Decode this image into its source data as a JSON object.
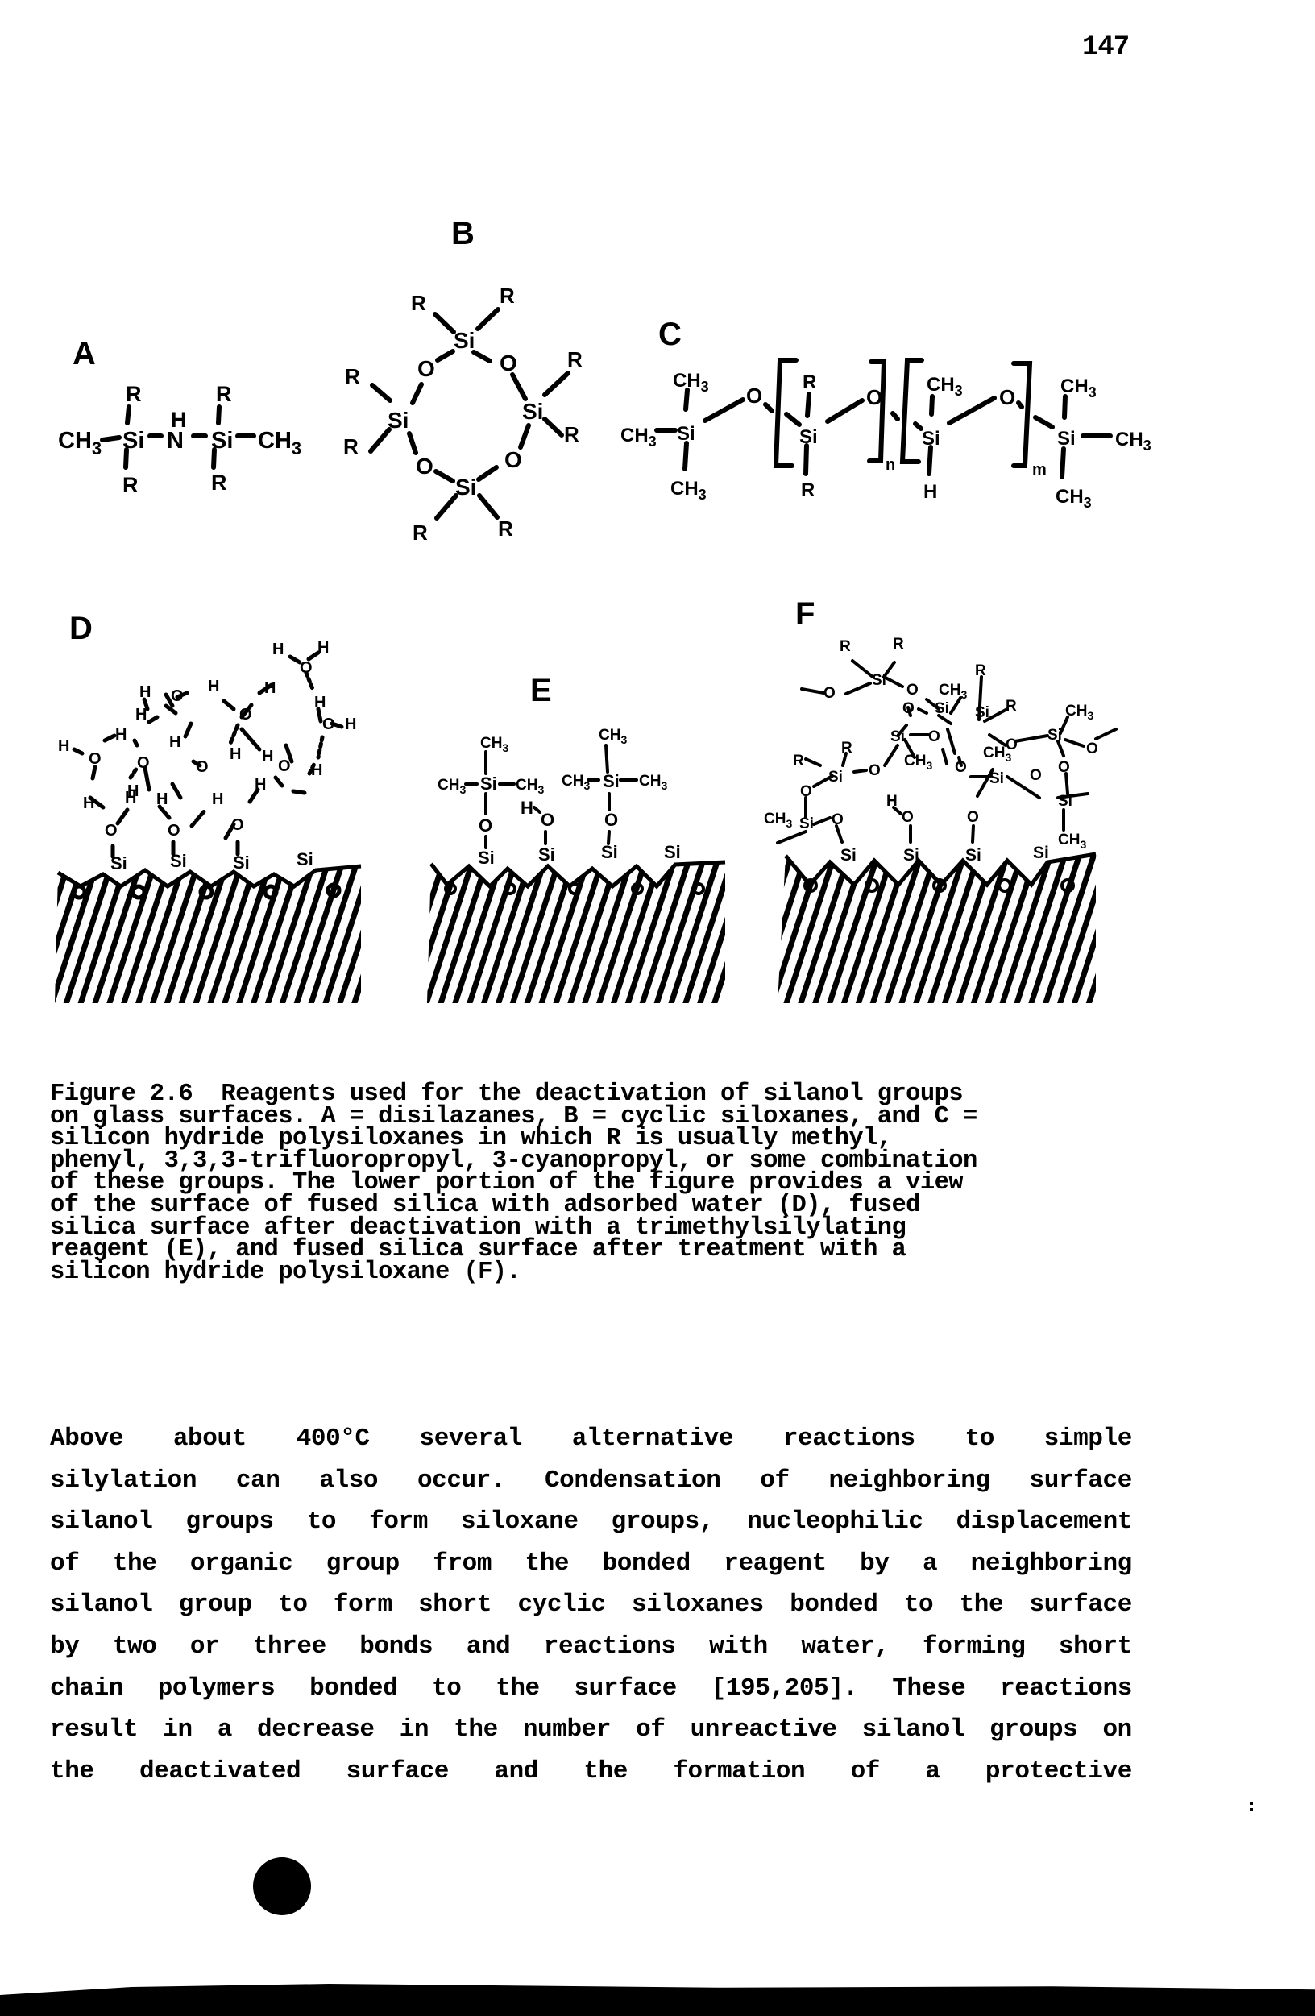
{
  "page": {
    "number": "147"
  },
  "figure": {
    "panel_labels": {
      "a": "A",
      "b": "B",
      "c": "C",
      "d": "D",
      "e": "E",
      "f": "F"
    },
    "atoms": {
      "si": "Si",
      "o": "O",
      "h": "H",
      "n": "N",
      "r": "R",
      "ch3": "CH3",
      "ch3_sub": "3",
      "ch": "CH",
      "n_sub": "n",
      "m_sub": "m"
    },
    "panels": [
      {
        "label": "A",
        "description": "disilazane: CH3-Si(R)2-NH-Si(R)2-CH3"
      },
      {
        "label": "B",
        "description": "cyclic siloxane: tetrameric ring of Si(R)2-O units"
      },
      {
        "label": "C",
        "description": "silicon hydride polysiloxane: (CH3)3Si-O-[Si(R)2-O]n-[Si(CH3)(H)-O]m-Si(CH3)3"
      },
      {
        "label": "D",
        "description": "fused silica surface with adsorbed water"
      },
      {
        "label": "E",
        "description": "fused silica surface after trimethylsilylation"
      },
      {
        "label": "F",
        "description": "fused silica surface after treatment with a silicon hydride polysiloxane"
      }
    ]
  },
  "caption": {
    "lines": [
      "Figure 2.6  Reagents used for the deactivation of silanol groups",
      "on glass surfaces. A = disilazanes, B = cyclic siloxanes, and C =",
      "silicon hydride polysiloxanes in which R is usually methyl,",
      "phenyl, 3,3,3-trifluoropropyl, 3-cyanopropyl, or some combination",
      "of these groups. The lower portion of the figure provides a view",
      "of the surface of fused silica with adsorbed water (D), fused",
      "silica surface after deactivation with a trimethylsilylating",
      "reagent (E), and fused silica surface after treatment with a",
      "silicon hydride polysiloxane (F)."
    ]
  },
  "body": {
    "lines": [
      "Above about 400°C several alternative reactions to simple",
      "silylation can also occur. Condensation of neighboring surface",
      "silanol groups to form siloxane groups, nucleophilic displacement",
      "of the organic group from the bonded reagent by a neighboring",
      "silanol group to form short cyclic siloxanes bonded to the surface",
      "by two or three bonds and reactions with water, forming short",
      "chain polymers bonded to the surface [195,205]. These reactions",
      "result in a decrease in the number of unreactive silanol groups on",
      "the deactivated surface and the formation of a protective"
    ]
  }
}
